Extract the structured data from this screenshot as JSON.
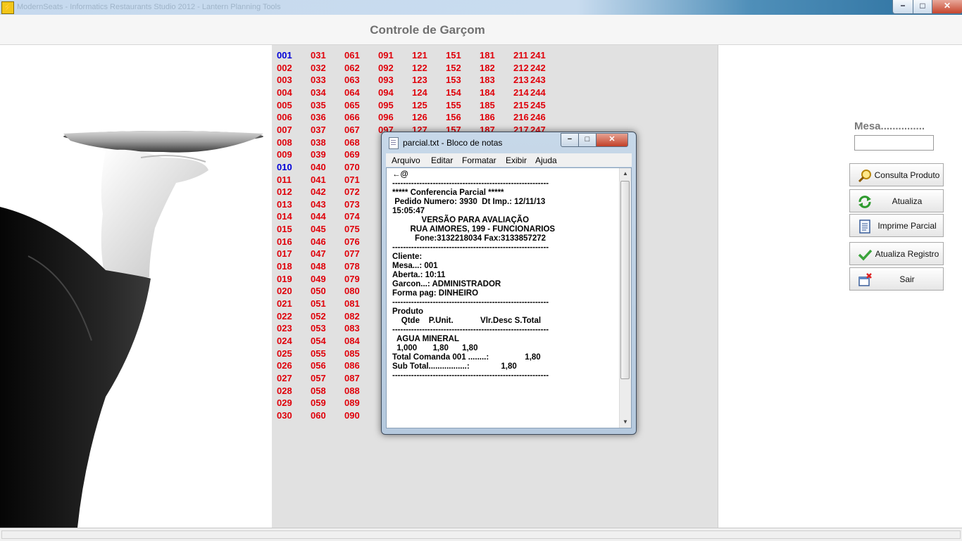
{
  "window": {
    "title": "ModernSeats - Informatics Restaurants Studio 2012 - Lantern Planning Tools",
    "minimize": "−",
    "maximize": "□",
    "close": "✕"
  },
  "header": {
    "title": "Controle de Garçom"
  },
  "tables": [
    [
      "001",
      "002",
      "003",
      "004",
      "005",
      "006",
      "007",
      "008",
      "009",
      "010",
      "011",
      "012",
      "013",
      "014",
      "015",
      "016",
      "017",
      "018",
      "019",
      "020",
      "021",
      "022",
      "023",
      "024",
      "025",
      "026",
      "027",
      "028",
      "029",
      "030"
    ],
    [
      "031",
      "032",
      "033",
      "034",
      "035",
      "036",
      "037",
      "038",
      "039",
      "040",
      "041",
      "042",
      "043",
      "044",
      "045",
      "046",
      "047",
      "048",
      "049",
      "050",
      "051",
      "052",
      "053",
      "054",
      "055",
      "056",
      "057",
      "058",
      "059",
      "060"
    ],
    [
      "061",
      "062",
      "063",
      "064",
      "065",
      "066",
      "067",
      "068",
      "069",
      "070",
      "071",
      "072",
      "073",
      "074",
      "075",
      "076",
      "077",
      "078",
      "079",
      "080",
      "081",
      "082",
      "083",
      "084",
      "085",
      "086",
      "087",
      "088",
      "089",
      "090"
    ],
    [
      "091",
      "092",
      "093",
      "094",
      "095",
      "096",
      "097"
    ],
    [
      "121",
      "122",
      "123",
      "124",
      "125",
      "126",
      "127"
    ],
    [
      "151",
      "152",
      "153",
      "154",
      "155",
      "156",
      "157"
    ],
    [
      "181",
      "182",
      "183",
      "184",
      "185",
      "186",
      "187"
    ],
    [
      "211",
      "212",
      "213",
      "214",
      "215",
      "216",
      "217"
    ],
    [
      "241",
      "242",
      "243",
      "244",
      "245",
      "246",
      "247"
    ]
  ],
  "selected_tables": [
    "001",
    "010"
  ],
  "right_panel": {
    "mesa_label": "Mesa...............",
    "mesa_value": "",
    "buttons": [
      {
        "label": "Consulta Produto",
        "icon": "search-icon"
      },
      {
        "label": "Atualiza",
        "icon": "refresh-icon"
      },
      {
        "label": "Imprime Parcial",
        "icon": "document-icon"
      },
      {
        "label": "Atualiza Registro",
        "icon": "check-icon"
      },
      {
        "label": "Sair",
        "icon": "exit-icon"
      }
    ]
  },
  "notepad": {
    "title": "parcial.txt - Bloco de notas",
    "menu": [
      "Arquivo",
      "Editar",
      "Formatar",
      "Exibir",
      "Ajuda"
    ],
    "content": "←@\n----------------------------------------------------------\n***** Conferencia Parcial *****\n Pedido Numero: 3930  Dt Imp.: 12/11/13\n15:05:47\n             VERSÃO PARA AVALIAÇÃO\n        RUA AIMORES, 199 - FUNCIONARIOS\n          Fone:3132218034 Fax:3133857272\n----------------------------------------------------------\nCliente:\nMesa...: 001\nAberta.: 10:11\nGarcon...: ADMINISTRADOR\nForma pag: DINHEIRO\n----------------------------------------------------------\nProduto\n    Qtde    P.Unit.            Vlr.Desc S.Total\n----------------------------------------------------------\n  AGUA MINERAL\n  1,000       1,80      1,80\nTotal Comanda 001 ........:                1,80\nSub Total.................:              1,80\n----------------------------------------------------------"
  }
}
